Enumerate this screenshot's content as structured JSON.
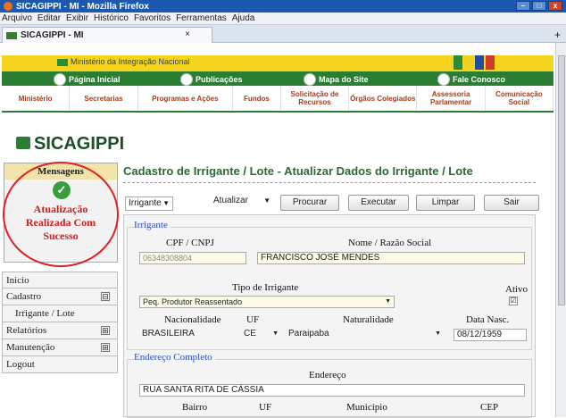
{
  "browser": {
    "window_title": "SICAGIPPI - MI - Mozilla Firefox",
    "menu": [
      "Arquivo",
      "Editar",
      "Exibir",
      "Histórico",
      "Favoritos",
      "Ferramentas",
      "Ajuda"
    ],
    "tab_title": "SICAGIPPI - MI",
    "tab_close": "×",
    "new_tab": "+"
  },
  "header": {
    "ministry": "Ministério da Integração Nacional",
    "nav": [
      "Página Inicial",
      "Publicações",
      "Mapa do Site",
      "Fale Conosco"
    ],
    "menu": [
      "Ministério",
      "Secretarias",
      "Programas e Ações",
      "Fundos",
      "Solicitação de Recursos",
      "Órgãos Colegiados",
      "Assessoria Parlamentar",
      "Comunicação Social"
    ]
  },
  "logo": "SICAGIPPI",
  "messages": {
    "title": "Mensagens",
    "text": "Atualização Realizada Com Sucesso"
  },
  "sidebar": {
    "items": [
      {
        "label": "Inicio",
        "expand": ""
      },
      {
        "label": "Cadastro",
        "expand": "⊟"
      },
      {
        "label": "Irrigante / Lote",
        "expand": ""
      },
      {
        "label": "Relatórios",
        "expand": "⊞"
      },
      {
        "label": "Manutenção",
        "expand": "⊞"
      },
      {
        "label": "Logout",
        "expand": ""
      }
    ]
  },
  "page_title": "Cadastro de Irrigante / Lote - Atualizar Dados do Irrigante / Lote",
  "toolbar": {
    "type_select": "Irrigante",
    "action_select": "Atualizar",
    "search": "Procurar",
    "execute": "Executar",
    "clear": "Limpar",
    "exit": "Sair"
  },
  "form": {
    "irrigante_legend": "Irrigante",
    "cpf_label": "CPF / CNPJ",
    "cpf_value": "06348308804",
    "name_label": "Nome / Razão Social",
    "name_value": "FRANCISCO JOSÉ MENDES",
    "tipo_label": "Tipo de Irrigante",
    "tipo_value": "Peq. Produtor Reassentado",
    "ativo_label": "Ativo",
    "ativo_checked": "☑",
    "nac_label": "Nacionalidade",
    "nac_value": "BRASILEIRA",
    "uf_label": "UF",
    "uf_value": "CE",
    "nat_label": "Naturalidade",
    "nat_value": "Paraipaba",
    "nasc_label": "Data Nasc.",
    "nasc_value": "08/12/1959",
    "endereco_legend": "Endereço Completo",
    "endereco_label": "Endereço",
    "endereco_value": "RUA SANTA RITA DE CÁSSIA",
    "bairro_label": "Bairro",
    "uf2_label": "UF",
    "municipio_label": "Municipio",
    "cep_label": "CEP"
  }
}
